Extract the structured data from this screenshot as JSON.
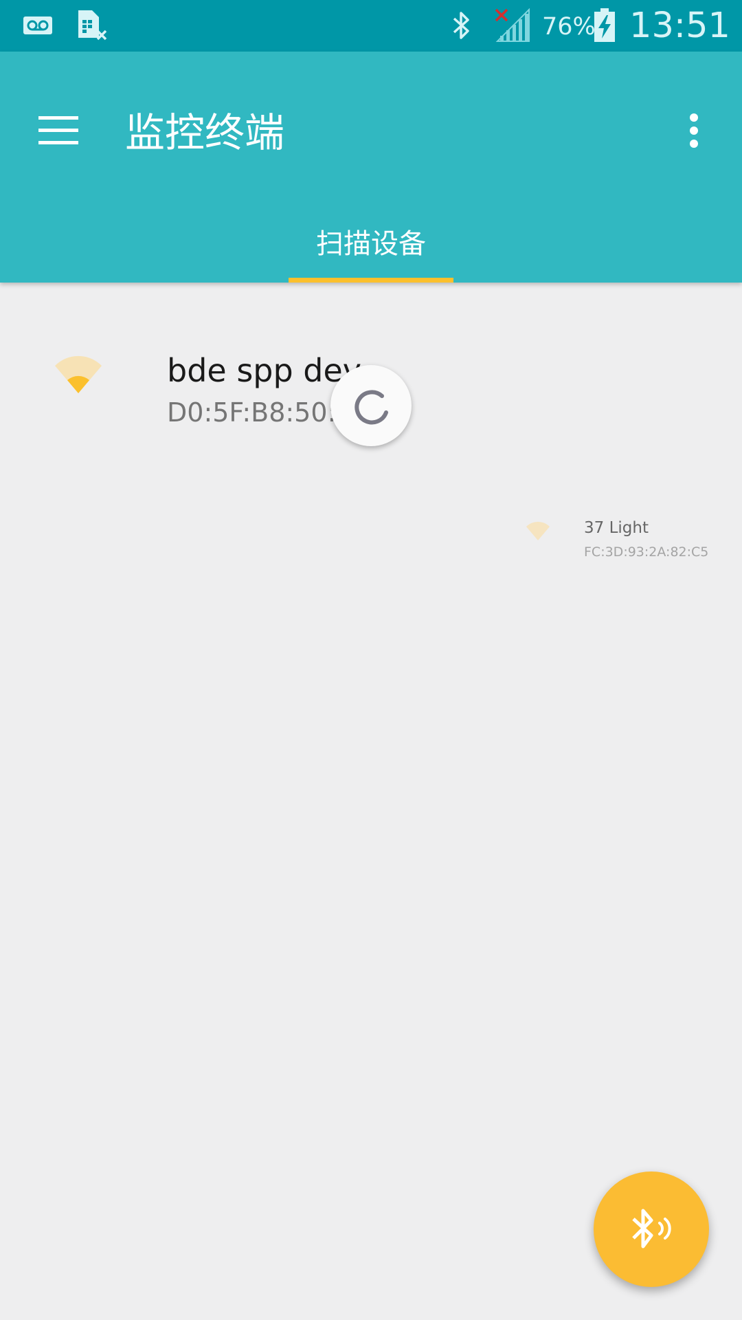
{
  "status_bar": {
    "icons": [
      "voicemail-icon",
      "sim-missing-icon",
      "bluetooth-icon",
      "no-signal-icon",
      "battery-charging-icon"
    ],
    "battery_percent": "76%",
    "time": "13:51"
  },
  "app_bar": {
    "title": "监控终端",
    "menu_icon": "hamburger-menu-icon",
    "overflow_icon": "more-vert-icon",
    "tabs": [
      {
        "label": "扫描设备",
        "selected": true
      }
    ]
  },
  "colors": {
    "status_bar": "#0097a7",
    "app_bar": "#31b8c1",
    "accent": "#fbc02d",
    "fab": "#fbbc33",
    "background": "#eeeeef"
  },
  "devices": [
    {
      "name": "bde spp dev",
      "address": "D0:5F:B8:50:4",
      "icon": "signal-strength-icon"
    },
    {
      "name": "37 Light",
      "address": "FC:3D:93:2A:82:C5",
      "icon": "signal-strength-icon"
    }
  ],
  "loading_indicator": {
    "icon": "progress-spinner-icon"
  },
  "fab": {
    "icon": "bluetooth-scan-icon"
  }
}
